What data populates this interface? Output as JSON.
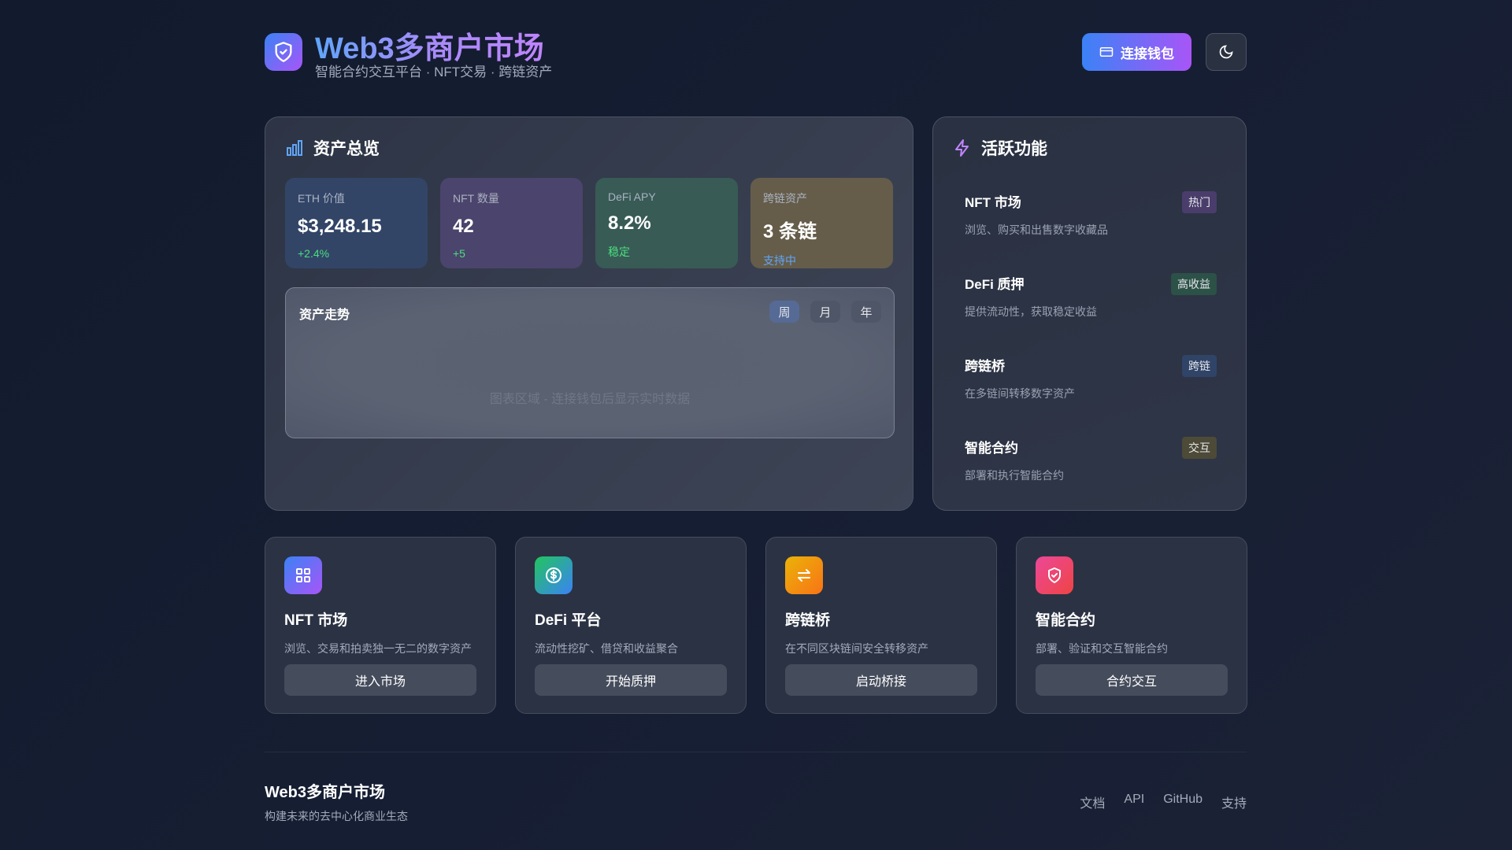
{
  "header": {
    "title": "Web3多商户市场",
    "subtitle": "智能合约交互平台 · NFT交易 · 跨链资产",
    "connect_label": "连接钱包"
  },
  "assets": {
    "title": "资产总览",
    "stats": [
      {
        "label": "ETH 价值",
        "value": "$3,248.15",
        "change": "+2.4%",
        "bg": "#324567",
        "changeColor": "#4ade80"
      },
      {
        "label": "NFT 数量",
        "value": "42",
        "change": "+5",
        "bg": "#4b446c",
        "changeColor": "#4ade80"
      },
      {
        "label": "DeFi APY",
        "value": "8.2%",
        "change": "稳定",
        "bg": "#385b55",
        "changeColor": "#4ade80"
      },
      {
        "label": "跨链资产",
        "value": "3 条链",
        "change": "支持中",
        "bg": "#655d4a",
        "changeColor": "#60a5fa"
      }
    ],
    "chart": {
      "title": "资产走势",
      "ranges": [
        "周",
        "月",
        "年"
      ],
      "empty": "图表区域 - 连接钱包后显示实时数据"
    }
  },
  "active": {
    "title": "活跃功能",
    "items": [
      {
        "name": "NFT 市场",
        "desc": "浏览、购买和出售数字收藏品",
        "badge": "热门",
        "badgeBg": "#4a3d6b"
      },
      {
        "name": "DeFi 质押",
        "desc": "提供流动性，获取稳定收益",
        "badge": "高收益",
        "badgeBg": "#2c5147"
      },
      {
        "name": "跨链桥",
        "desc": "在多链间转移数字资产",
        "badge": "跨链",
        "badgeBg": "#304468"
      },
      {
        "name": "智能合约",
        "desc": "部署和执行智能合约",
        "badge": "交互",
        "badgeBg": "#4d4a38"
      }
    ]
  },
  "cards": [
    {
      "title": "NFT 市场",
      "desc": "浏览、交易和拍卖独一无二的数字资产",
      "button": "进入市场",
      "icon": "grid-icon"
    },
    {
      "title": "DeFi 平台",
      "desc": "流动性挖矿、借贷和收益聚合",
      "button": "开始质押",
      "icon": "dollar-icon"
    },
    {
      "title": "跨链桥",
      "desc": "在不同区块链间安全转移资产",
      "button": "启动桥接",
      "icon": "swap-icon"
    },
    {
      "title": "智能合约",
      "desc": "部署、验证和交互智能合约",
      "button": "合约交互",
      "icon": "shield-check-icon"
    }
  ],
  "footer": {
    "title": "Web3多商户市场",
    "subtitle": "构建未来的去中心化商业生态",
    "links": [
      "文档",
      "API",
      "GitHub",
      "支持"
    ]
  }
}
